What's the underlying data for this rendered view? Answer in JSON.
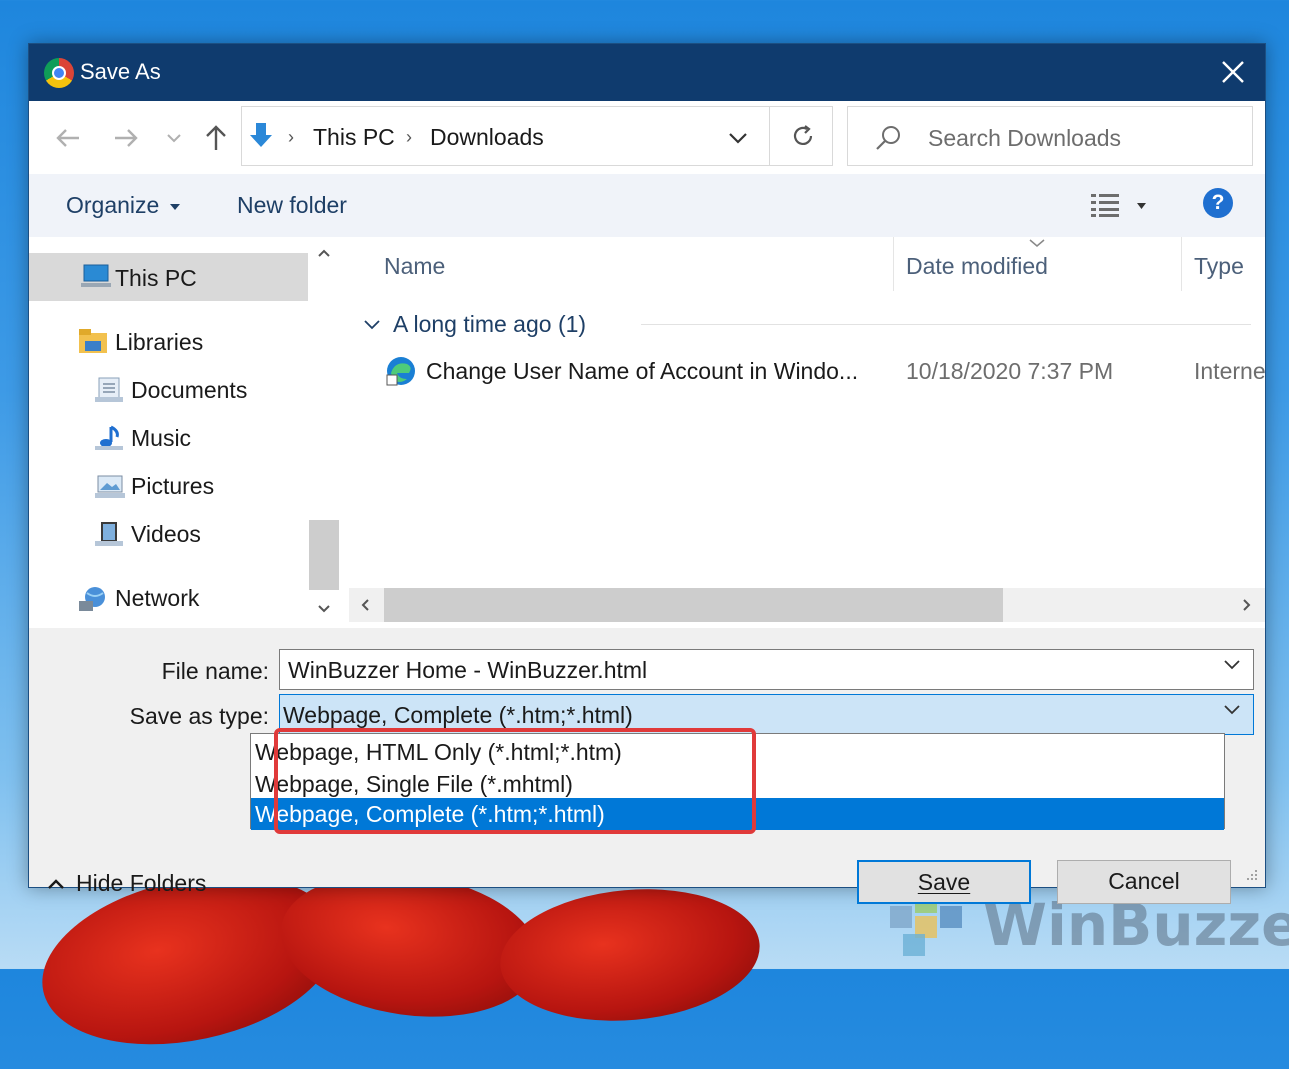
{
  "window": {
    "title": "Save As"
  },
  "nav": {
    "breadcrumb": [
      "This PC",
      "Downloads"
    ],
    "search_placeholder": "Search Downloads"
  },
  "toolbar": {
    "organize": "Organize",
    "new_folder": "New folder",
    "help": "?"
  },
  "sidebar": {
    "items": [
      {
        "label": "This PC",
        "icon": "pc-icon"
      },
      {
        "label": "Libraries",
        "icon": "libraries-icon"
      },
      {
        "label": "Documents",
        "icon": "documents-icon"
      },
      {
        "label": "Music",
        "icon": "music-icon"
      },
      {
        "label": "Pictures",
        "icon": "pictures-icon"
      },
      {
        "label": "Videos",
        "icon": "videos-icon"
      },
      {
        "label": "Network",
        "icon": "network-icon"
      }
    ]
  },
  "file_list": {
    "columns": [
      "Name",
      "Date modified",
      "Type"
    ],
    "group": "A long time ago (1)",
    "rows": [
      {
        "name": "Change User Name of Account in Windo...",
        "date": "10/18/2020 7:37 PM",
        "type": "Interne"
      }
    ]
  },
  "form": {
    "file_name_label": "File name:",
    "file_name_value": "WinBuzzer Home - WinBuzzer.html",
    "save_type_label": "Save as type:",
    "save_type_value": "Webpage, Complete (*.htm;*.html)",
    "options": [
      "Webpage, HTML Only (*.html;*.htm)",
      "Webpage, Single File (*.mhtml)",
      "Webpage, Complete (*.htm;*.html)"
    ]
  },
  "buttons": {
    "save": "Save",
    "cancel": "Cancel",
    "hide_folders": "Hide Folders"
  },
  "watermark": {
    "text": "WinBuzzer"
  }
}
